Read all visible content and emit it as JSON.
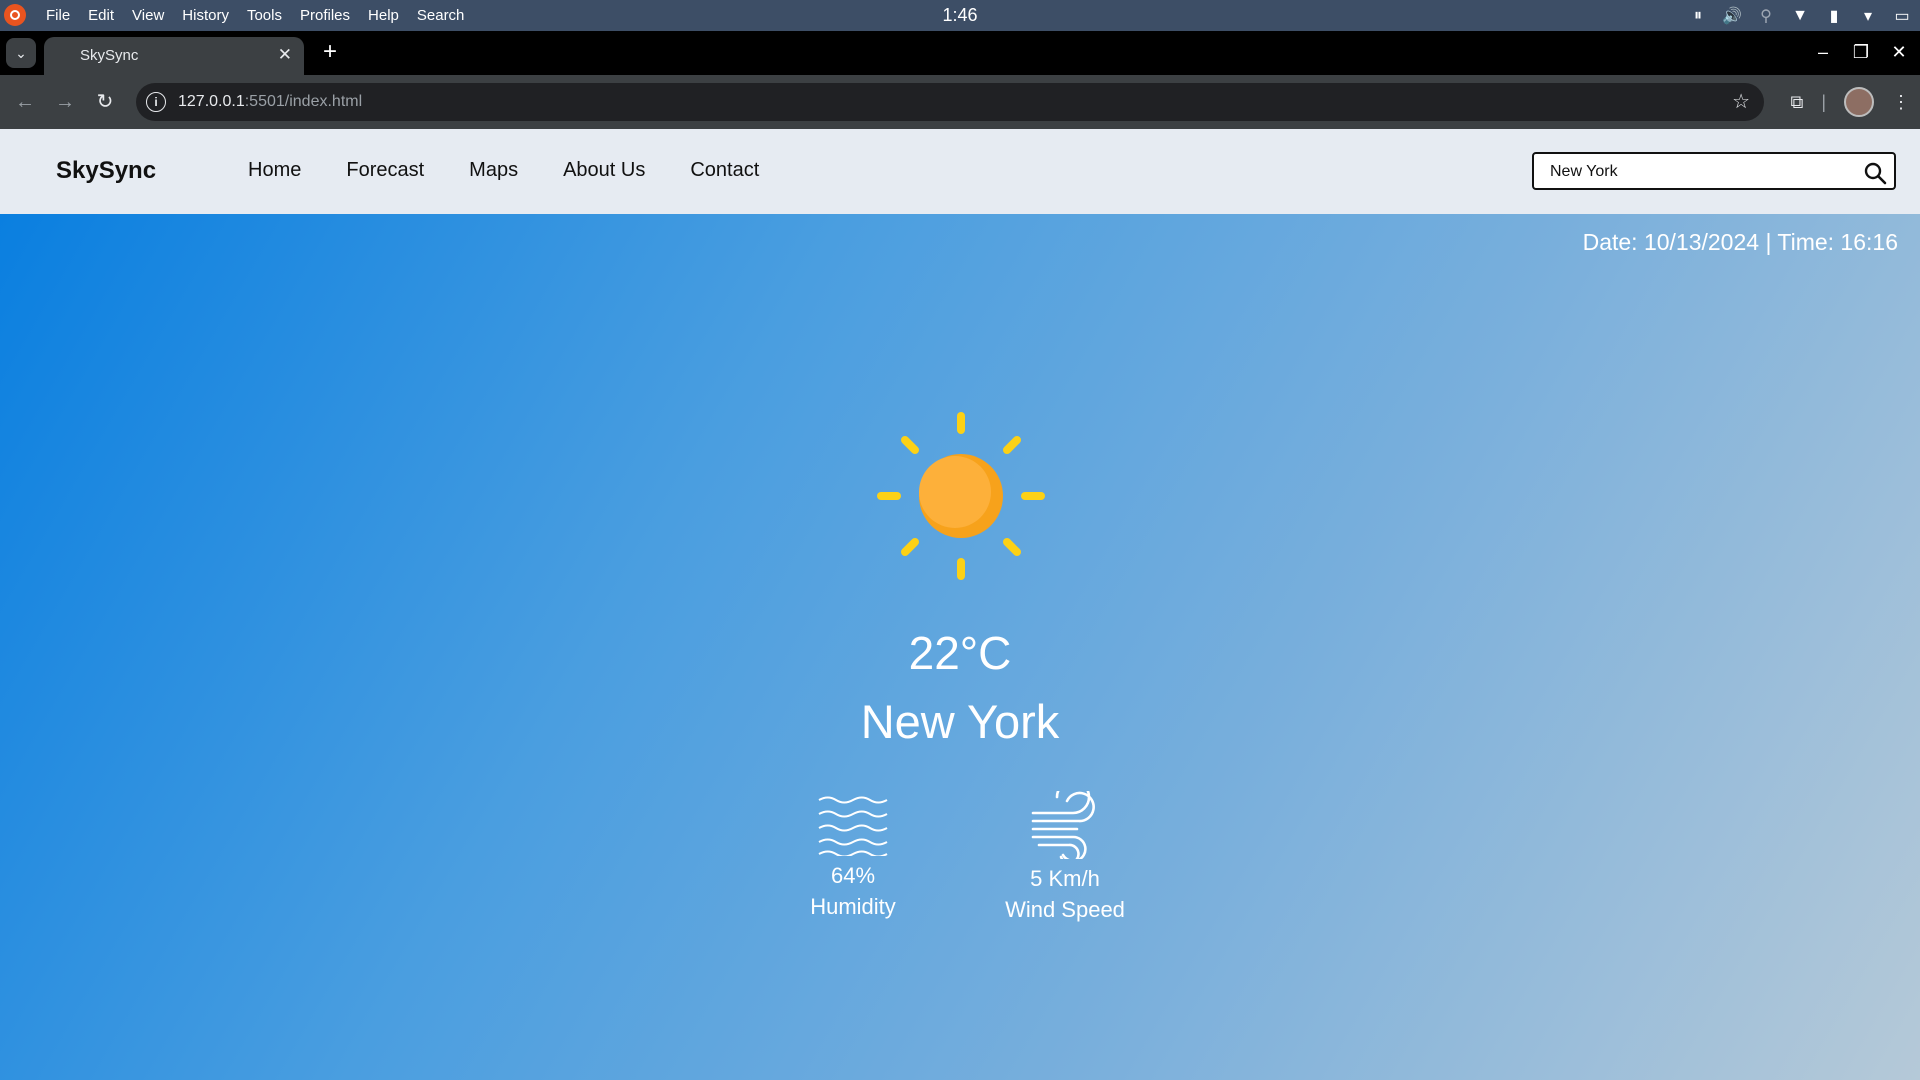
{
  "os": {
    "menu": [
      "File",
      "Edit",
      "View",
      "History",
      "Tools",
      "Profiles",
      "Help",
      "Search"
    ],
    "clock": "1:46"
  },
  "browser": {
    "tab_title": "SkySync",
    "url_host": "127.0.0.1",
    "url_rest": ":5501/index.html"
  },
  "site": {
    "brand": "SkySync",
    "nav": [
      "Home",
      "Forecast",
      "Maps",
      "About Us",
      "Contact"
    ],
    "search_value": "New York"
  },
  "weather": {
    "datetime": "Date: 10/13/2024 | Time: 16:16",
    "temperature": "22°C",
    "city": "New York",
    "humidity_value": "64%",
    "humidity_label": "Humidity",
    "wind_value": "5 Km/h",
    "wind_label": "Wind Speed",
    "icon": "sun-icon"
  },
  "colors": {
    "sun_body": "#fdb03a",
    "sun_rays": "#fcd116"
  }
}
